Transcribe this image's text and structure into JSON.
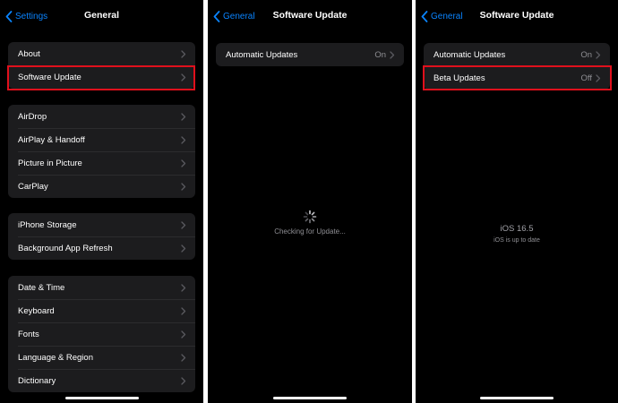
{
  "screens": [
    {
      "back_label": "Settings",
      "title": "General",
      "groups": [
        [
          "About",
          "Software Update"
        ],
        [
          "AirDrop",
          "AirPlay & Handoff",
          "Picture in Picture",
          "CarPlay"
        ],
        [
          "iPhone Storage",
          "Background App Refresh"
        ],
        [
          "Date & Time",
          "Keyboard",
          "Fonts",
          "Language & Region",
          "Dictionary"
        ]
      ],
      "highlighted_item": "Software Update"
    },
    {
      "back_label": "General",
      "title": "Software Update",
      "automatic_updates": {
        "label": "Automatic Updates",
        "value": "On"
      },
      "status_text": "Checking for Update..."
    },
    {
      "back_label": "General",
      "title": "Software Update",
      "automatic_updates": {
        "label": "Automatic Updates",
        "value": "On"
      },
      "beta_updates": {
        "label": "Beta Updates",
        "value": "Off"
      },
      "highlighted_item": "Beta Updates",
      "ios_version": "iOS 16.5",
      "ios_status": "iOS is up to date"
    }
  ],
  "colors": {
    "accent": "#0a84ff",
    "highlight": "#e0101c",
    "cell_background": "#1c1c1e",
    "screen_background": "#000000"
  },
  "icons": [
    "chevron-left-icon",
    "chevron-right-icon",
    "spinner-icon"
  ]
}
